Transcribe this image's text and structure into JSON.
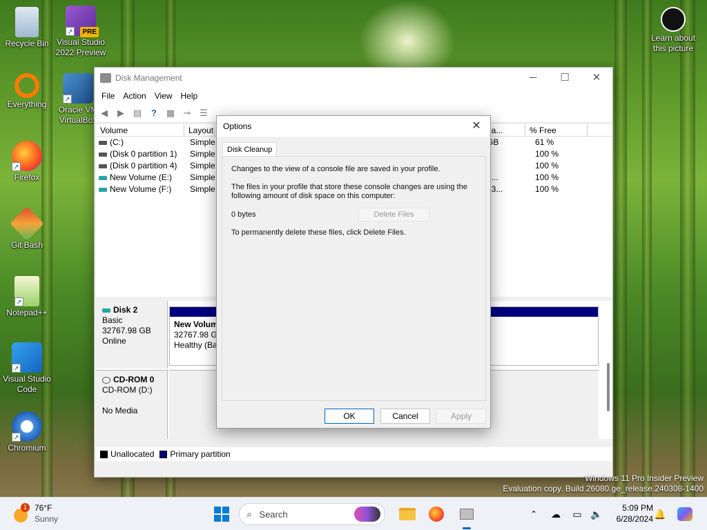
{
  "desktop": {
    "icons": [
      {
        "label": "Recycle Bin"
      },
      {
        "label": "Visual Studio 2022 Preview",
        "badge": "PRE"
      },
      {
        "label": "Everything"
      },
      {
        "label": "Oracle VM VirtualBox"
      },
      {
        "label": "Firefox"
      },
      {
        "label": "Git Bash"
      },
      {
        "label": "Notepad++"
      },
      {
        "label": "Visual Studio Code"
      },
      {
        "label": "Chromium"
      }
    ],
    "learn_about_label": "Learn about this picture",
    "watermark": {
      "line1": "Windows 11 Pro Insider Preview",
      "line2": "Evaluation copy. Build 26080.ge_release.240308-1400"
    }
  },
  "disk_management": {
    "title": "Disk Management",
    "menu": [
      "File",
      "Action",
      "View",
      "Help"
    ],
    "columns": [
      "Volume",
      "Layout",
      "pa...",
      "% Free"
    ],
    "volumes": [
      {
        "name": "(C:)",
        "layout": "Simple",
        "cap": "GB",
        "free": "61 %"
      },
      {
        "name": "(Disk 0 partition 1)",
        "layout": "Simple",
        "cap": "3",
        "free": "100 %"
      },
      {
        "name": "(Disk 0 partition 4)",
        "layout": "Simple",
        "cap": "3",
        "free": "100 %"
      },
      {
        "name": "New Volume (E:)",
        "layout": "Simple",
        "cap": "2...",
        "free": "100 %"
      },
      {
        "name": "New Volume (F:)",
        "layout": "Simple",
        "cap": "33...",
        "free": "100 %"
      }
    ],
    "disk2": {
      "name": "Disk 2",
      "type": "Basic",
      "size": "32767.98 GB",
      "status": "Online"
    },
    "disk2_partition": {
      "name": "New Volum",
      "size": "32767.98 GB",
      "status": "Healthy (Bas"
    },
    "cdrom": {
      "name": "CD-ROM 0",
      "line1": "CD-ROM (D:)",
      "line2": "No Media"
    },
    "legend": {
      "unallocated": "Unallocated",
      "primary": "Primary partition"
    }
  },
  "options_dialog": {
    "title": "Options",
    "tab": "Disk Cleanup",
    "text1": "Changes to the view of a console file are saved in your profile.",
    "text2": "The files in your profile that store these console changes are using the following amount of disk space on this computer:",
    "size_value": "0 bytes",
    "delete_button": "Delete Files",
    "text3": "To permanently delete these files, click Delete Files.",
    "ok": "OK",
    "cancel": "Cancel",
    "apply": "Apply"
  },
  "taskbar": {
    "weather": {
      "temp": "76°F",
      "condition": "Sunny",
      "alert": "1"
    },
    "search_placeholder": "Search",
    "time": "5:09 PM",
    "date": "6/28/2024"
  }
}
